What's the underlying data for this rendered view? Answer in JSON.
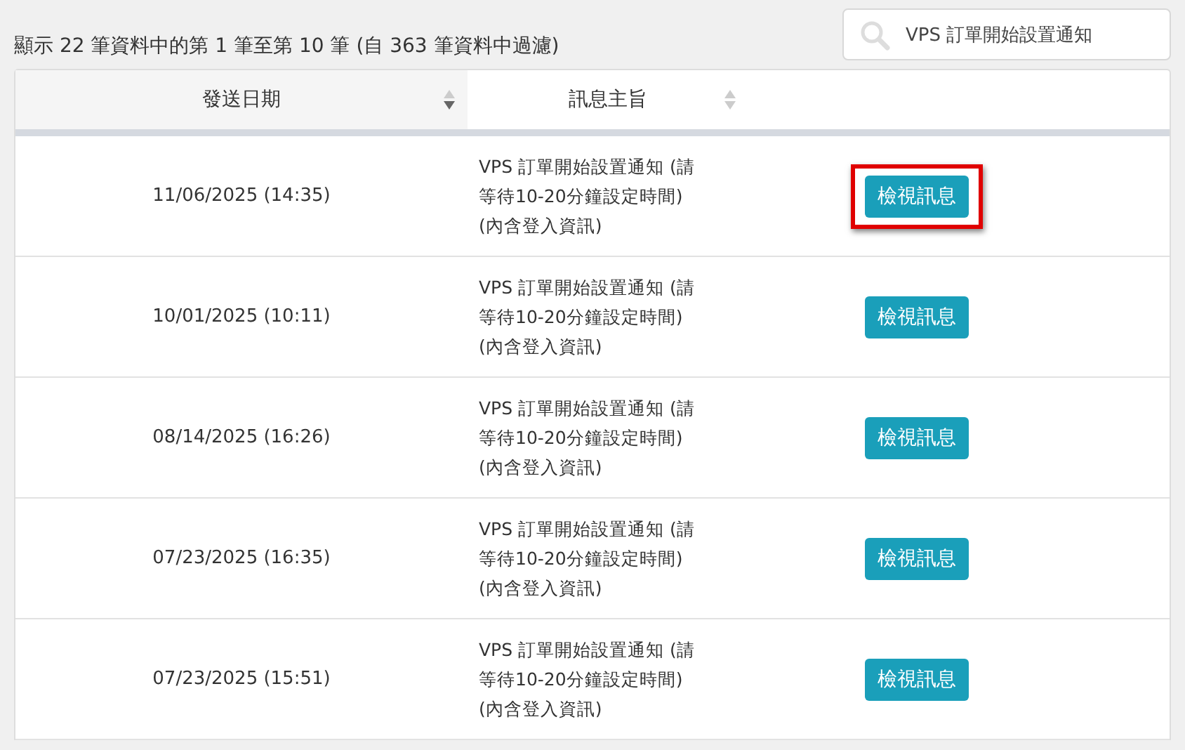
{
  "summary": "顯示 22 筆資料中的第 1 筆至第 10 筆 (自 363 筆資料中過濾)",
  "search": {
    "value": "VPS 訂單開始設置通知"
  },
  "table": {
    "columns": [
      {
        "label": "發送日期",
        "sorted": true
      },
      {
        "label": "訊息主旨",
        "sorted": false
      }
    ],
    "rows": [
      {
        "date": "11/06/2025 (14:35)",
        "subject": "VPS 訂單開始設置通知 (請等待10-20分鐘設定時間) (內含登入資訊)",
        "button": "檢視訊息",
        "highlighted": true
      },
      {
        "date": "10/01/2025 (10:11)",
        "subject": "VPS 訂單開始設置通知 (請等待10-20分鐘設定時間) (內含登入資訊)",
        "button": "檢視訊息",
        "highlighted": false
      },
      {
        "date": "08/14/2025 (16:26)",
        "subject": "VPS 訂單開始設置通知 (請等待10-20分鐘設定時間) (內含登入資訊)",
        "button": "檢視訊息",
        "highlighted": false
      },
      {
        "date": "07/23/2025 (16:35)",
        "subject": "VPS 訂單開始設置通知 (請等待10-20分鐘設定時間) (內含登入資訊)",
        "button": "檢視訊息",
        "highlighted": false
      },
      {
        "date": "07/23/2025 (15:51)",
        "subject": "VPS 訂單開始設置通知 (請等待10-20分鐘設定時間) (內含登入資訊)",
        "button": "檢視訊息",
        "highlighted": false
      }
    ]
  }
}
